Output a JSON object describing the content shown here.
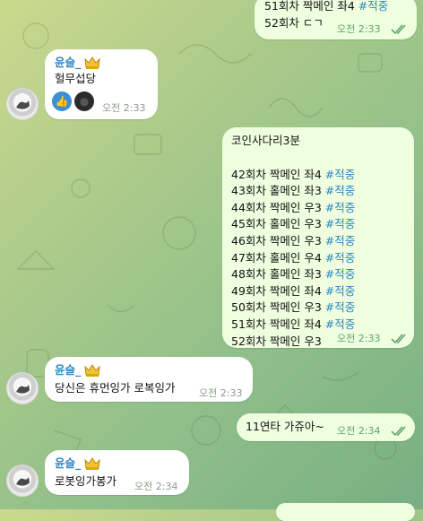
{
  "chat": {
    "m1": {
      "lines": [
        "51회차 짝메인 좌4 ",
        "52회차 ㄷㄱ"
      ],
      "tag": "#적중",
      "time": "오전 2:33"
    },
    "m2": {
      "sender": "윤슬_",
      "text": "헐무섭당",
      "time": "오전 2:33",
      "reactions": [
        {
          "name": "thumbs-up",
          "glyph": "👍"
        },
        {
          "name": "dark-sticker",
          "glyph": "●"
        }
      ]
    },
    "m3": {
      "title": "코인사다리3분",
      "rows": [
        {
          "text": "42회차 짝메인 좌4 ",
          "tag": "#적중"
        },
        {
          "text": "43회차 홀메인 좌3 ",
          "tag": "#적중"
        },
        {
          "text": "44회차 짝메인 우3 ",
          "tag": "#적중"
        },
        {
          "text": "45회차 홀메인 우3 ",
          "tag": "#적중"
        },
        {
          "text": "46회차 짝메인 우3 ",
          "tag": "#적중"
        },
        {
          "text": "47회차 홀메인 우4 ",
          "tag": "#적중"
        },
        {
          "text": "48회차 홀메인 좌3 ",
          "tag": "#적중"
        },
        {
          "text": "49회차 짝메인 좌4 ",
          "tag": "#적중"
        },
        {
          "text": "50회차 짝메인 우3 ",
          "tag": "#적중"
        },
        {
          "text": "51회차 짝메인 좌4 ",
          "tag": "#적중"
        },
        {
          "text": "52회차 짝메인 우3",
          "tag": ""
        }
      ],
      "time": "오전 2:33"
    },
    "m4": {
      "sender": "윤슬_",
      "text": "당신은 휴먼잉가 로복잉가",
      "time": "오전 2:33"
    },
    "m5": {
      "text": "11연타 가쥬아~",
      "time": "오전 2:34"
    },
    "m6": {
      "sender": "윤슬_",
      "text": "로봇잉가봉가",
      "time": "오전 2:34"
    }
  },
  "colors": {
    "link": "#2e86c1",
    "outgoing": "#eefedf",
    "incoming": "#ffffff",
    "check": "#5fa46a"
  }
}
